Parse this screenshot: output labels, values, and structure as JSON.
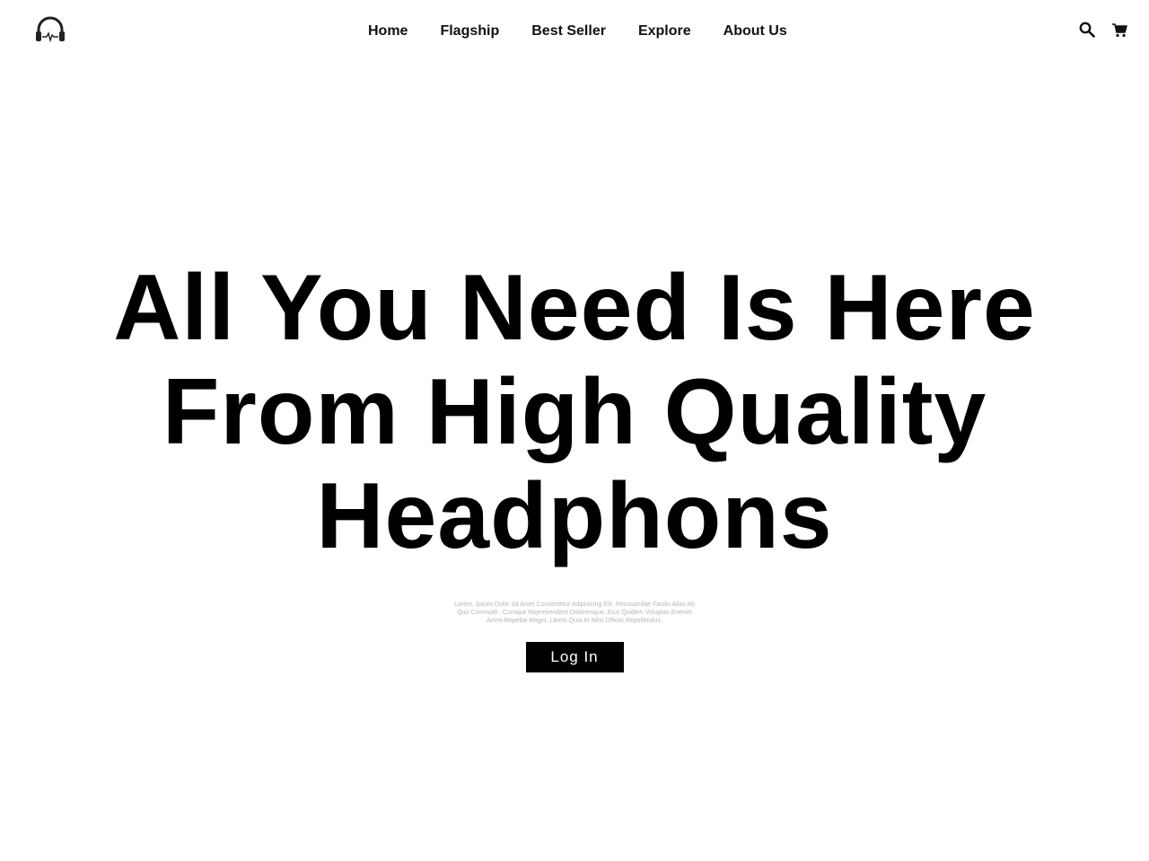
{
  "header": {
    "logo_icon": "headphones-heartbeat-icon",
    "nav": [
      {
        "label": "Home"
      },
      {
        "label": "Flagship"
      },
      {
        "label": "Best Seller"
      },
      {
        "label": "Explore"
      },
      {
        "label": "About Us"
      }
    ],
    "icons": [
      "search-icon",
      "cart-icon"
    ]
  },
  "hero": {
    "headline": "All You Need Is Here From High Quality Headphons",
    "description": "Lorem, Ipsum Dolor Sit Amet Consectetur Adipisicing Elit. Recusandae Facilis Alias Ab Quo Commodi , Cumque Reprehenderit Doloremque, Eius Quidem Voluptas Eveniet Animi Repellat Magni, Libero Quia At Nihil Officiis Repellendus.",
    "login_label": "Log In"
  },
  "colors": {
    "background": "#ffffff",
    "text": "#000000",
    "button_bg": "#000000",
    "button_text": "#ffffff",
    "muted_text": "#b5b5b5"
  }
}
